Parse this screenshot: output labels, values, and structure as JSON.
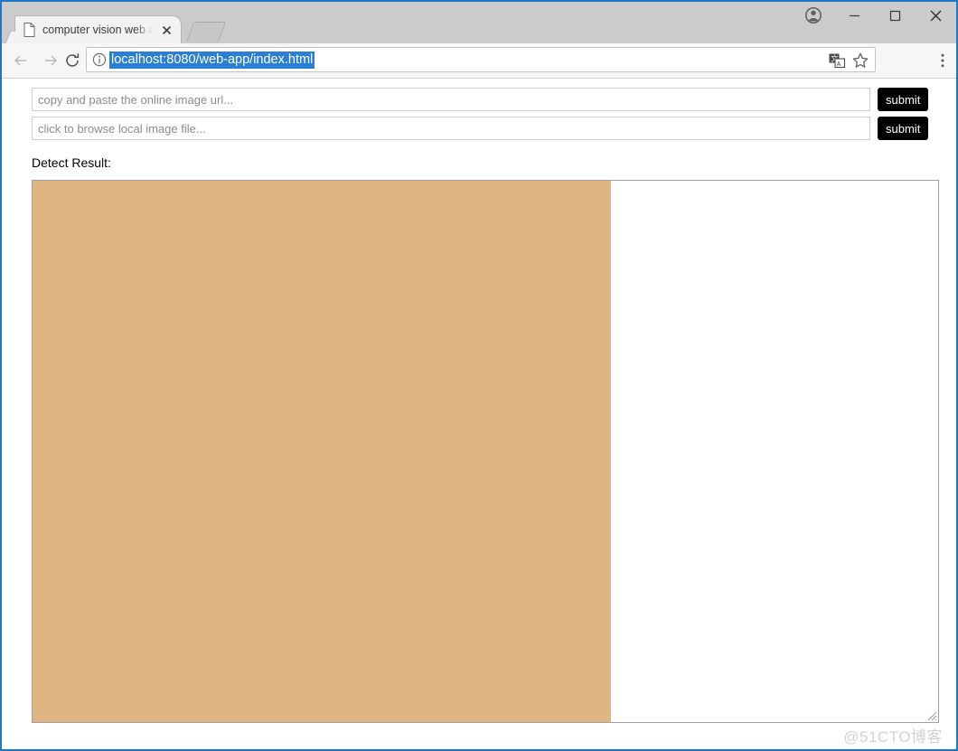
{
  "browser": {
    "tab": {
      "title": "computer vision web app",
      "favicon_icon": "page-icon",
      "close_icon": "close-icon"
    },
    "new_tab_icon": "new-tab-button",
    "window_controls": {
      "profile_icon": "profile-icon",
      "minimize_icon": "minimize-icon",
      "maximize_icon": "maximize-icon",
      "close_icon": "close-icon"
    },
    "toolbar": {
      "back_icon": "back-arrow-icon",
      "forward_icon": "forward-arrow-icon",
      "reload_icon": "reload-icon",
      "info_icon": "page-info-icon",
      "url": "localhost:8080/web-app/index.html",
      "url_selected": true,
      "translate_icon": "translate-icon",
      "bookmark_icon": "star-icon",
      "menu_icon": "three-dot-menu-icon"
    }
  },
  "page": {
    "url_input": {
      "placeholder": "copy and paste the online image url...",
      "value": ""
    },
    "file_input": {
      "placeholder": "click to browse local image file...",
      "value": ""
    },
    "submit_url_label": "submit",
    "submit_file_label": "submit",
    "detect_result_label": "Detect Result:",
    "result_image_color": "#dfb683",
    "resize_grip_icon": "resize-handle-icon"
  },
  "watermark": "@51CTO博客",
  "colors": {
    "window_border": "#1a7ac7",
    "titlebar": "#cbcbcb",
    "navbar": "#f6f6f6",
    "url_selection": "#2a7fd4",
    "submit_bg": "#000000",
    "image_tan": "#dfb683"
  }
}
